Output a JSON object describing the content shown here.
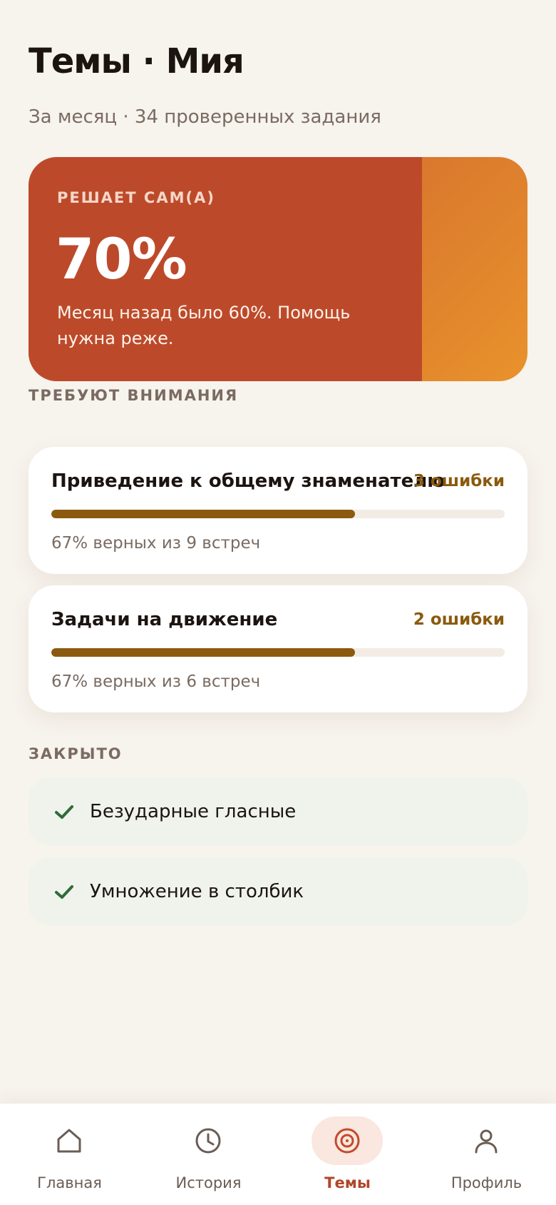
{
  "header": {
    "title": "Темы · Мия",
    "subtitle": "За месяц · 34 проверенных задания"
  },
  "hero": {
    "label": "РЕШАЕТ САМ(А)",
    "value": "70%",
    "note": "Месяц назад было 60%. Помощь нужна реже."
  },
  "attention": {
    "section_label": "ТРЕБУЮТ ВНИМАНИЯ",
    "items": [
      {
        "name": "Приведение к общему знаменателю",
        "errors": "3 ошибки",
        "progress_percent": 67,
        "stats": "67% верных из 9 встреч"
      },
      {
        "name": "Задачи на движение",
        "errors": "2 ошибки",
        "progress_percent": 67,
        "stats": "67% верных из 6 встреч"
      }
    ]
  },
  "closed": {
    "section_label": "ЗАКРЫТО",
    "items": [
      {
        "label": "Безударные гласные",
        "icon": "check-icon"
      },
      {
        "label": "Умножение в столбик",
        "icon": "check-icon"
      }
    ]
  },
  "nav": {
    "items": [
      {
        "label": "Главная",
        "icon": "home-icon",
        "active": false
      },
      {
        "label": "История",
        "icon": "clock-icon",
        "active": false
      },
      {
        "label": "Темы",
        "icon": "target-icon",
        "active": true
      },
      {
        "label": "Профиль",
        "icon": "user-icon",
        "active": false
      }
    ]
  },
  "colors": {
    "background": "#F7F3ED",
    "hero": "#BC4A2A",
    "accent_active": "#B0472A",
    "progress": "#8B5A0E",
    "success": "#2E6B3A"
  }
}
